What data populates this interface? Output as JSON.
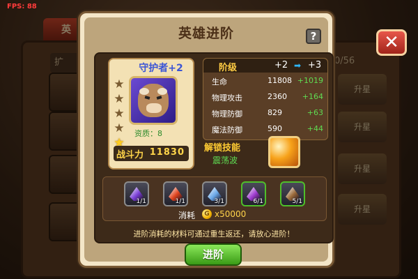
{
  "fps": "FPS: 88",
  "background": {
    "tab_label": "英",
    "left_tab_label": "扩",
    "count_label": "0/56",
    "row_button_label": "升星",
    "colors": {
      "close_button": "#d63b2c"
    }
  },
  "modal": {
    "title": "英雄进阶",
    "help_icon": "?",
    "close_icon": "close-icon"
  },
  "hero": {
    "name": "守护者+2",
    "stars_total": 5,
    "stars_lit": 1,
    "aptitude_label": "资质：",
    "aptitude_value": "8",
    "power_label": "战斗力",
    "power_value": "11830"
  },
  "stats": {
    "header_label": "阶级",
    "from_level": "+2",
    "arrow": "➡",
    "to_level": "+3",
    "rows": [
      {
        "name": "生命",
        "value": "11808",
        "increase": "+1019"
      },
      {
        "name": "物理攻击",
        "value": "2360",
        "increase": "+164"
      },
      {
        "name": "物理防御",
        "value": "829",
        "increase": "+63"
      },
      {
        "name": "魔法防御",
        "value": "590",
        "increase": "+44"
      }
    ]
  },
  "skill": {
    "title": "解锁技能",
    "name": "震荡波"
  },
  "materials": {
    "items": [
      {
        "name": "purple-tent-icon",
        "count": "1/1",
        "color": "#7a3fd6",
        "border": "#8c8c8c"
      },
      {
        "name": "red-tent-icon",
        "count": "1/1",
        "color": "#e0431e",
        "border": "#8c8c8c"
      },
      {
        "name": "blue-tent-icon",
        "count": "3/1",
        "color": "#6aa8e8",
        "border": "#8c8c8c"
      },
      {
        "name": "purple-crystal-icon",
        "count": "6/1",
        "color": "#a03cd0",
        "border": "#4fbf2a"
      },
      {
        "name": "brown-ore-icon",
        "count": "5/1",
        "color": "#9a6a3a",
        "border": "#4fbf2a"
      }
    ],
    "cost_label": "消耗",
    "coin_icon": "G",
    "cost_value": "x50000"
  },
  "notice": "进阶消耗的材料可通过重生返还，请放心进阶！",
  "advance_button": "进阶"
}
